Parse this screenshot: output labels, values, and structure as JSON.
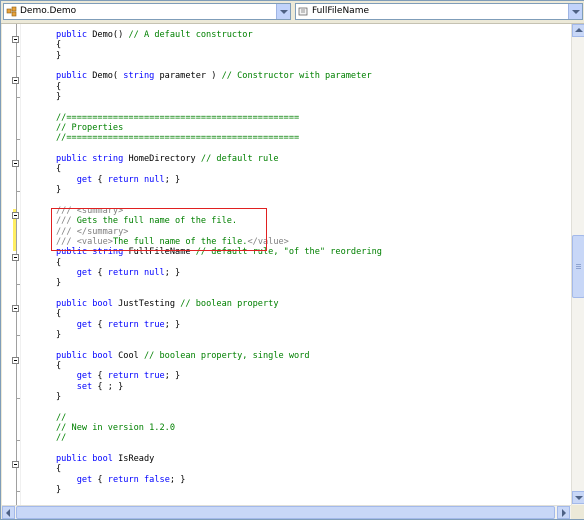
{
  "nav": {
    "class_combo": {
      "value": "Demo.Demo",
      "icon": "class-icon"
    },
    "member_combo": {
      "value": "FullFileName",
      "icon": "property-icon"
    }
  },
  "colors": {
    "keyword": "#0000ff",
    "comment": "#008000",
    "doc": "#808080",
    "highlight": "#e02020"
  },
  "code_lines": [
    "public Demo() // A default constructor",
    "{",
    "}",
    "",
    "public Demo( string parameter ) // Constructor with parameter",
    "{",
    "}",
    "",
    "//=============================================",
    "// Properties",
    "//=============================================",
    "",
    "public string HomeDirectory // default rule",
    "{",
    "    get { return null; }",
    "}",
    "",
    "/// <summary>",
    "/// Gets the full name of the file.",
    "/// </summary>",
    "/// <value>The full name of the file.</value>",
    "public string FullFileName // default rule, \"of the\" reordering",
    "{",
    "    get { return null; }",
    "}",
    "",
    "public bool JustTesting // boolean property",
    "{",
    "    get { return true; }",
    "}",
    "",
    "public bool Cool // boolean property, single word",
    "{",
    "    get { return true; }",
    "    set { ; }",
    "}",
    "",
    "//",
    "// New in version 1.2.0",
    "//",
    "",
    "public bool IsReady",
    "{",
    "    get { return false; }",
    "}"
  ]
}
